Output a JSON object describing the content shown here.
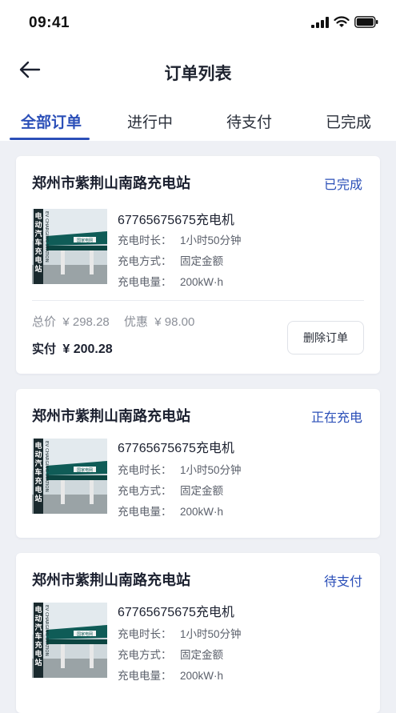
{
  "status_bar": {
    "time": "09:41"
  },
  "header": {
    "title": "订单列表"
  },
  "tabs": [
    {
      "label": "全部订单",
      "active": true
    },
    {
      "label": "进行中",
      "active": false
    },
    {
      "label": "待支付",
      "active": false
    },
    {
      "label": "已完成",
      "active": false
    }
  ],
  "labels": {
    "duration": "充电时长：",
    "method": "充电方式：",
    "energy": "充电电量：",
    "total": "总价",
    "discount": "优惠",
    "paid": "实付",
    "delete_button": "删除订单"
  },
  "orders": [
    {
      "station": "郑州市紫荆山南路充电站",
      "status": "已完成",
      "device": "67765675675充电机",
      "duration": "1小时50分钟",
      "method": "固定金额",
      "energy": "200kW·h",
      "total": "¥ 298.28",
      "discount": "¥ 98.00",
      "paid": "¥ 200.28"
    },
    {
      "station": "郑州市紫荆山南路充电站",
      "status": "正在充电",
      "device": "67765675675充电机",
      "duration": "1小时50分钟",
      "method": "固定金额",
      "energy": "200kW·h"
    },
    {
      "station": "郑州市紫荆山南路充电站",
      "status": "待支付",
      "device": "67765675675充电机",
      "duration": "1小时50分钟",
      "method": "固定金额",
      "energy": "200kW·h"
    }
  ],
  "thumb_text": {
    "vertical_cn": "电动汽车充电站",
    "vertical_en": "EV CHARGING STATION",
    "sign": "国家电网"
  },
  "colors": {
    "accent": "#2b4fb8",
    "background": "#eef0f5",
    "card": "#ffffff"
  }
}
